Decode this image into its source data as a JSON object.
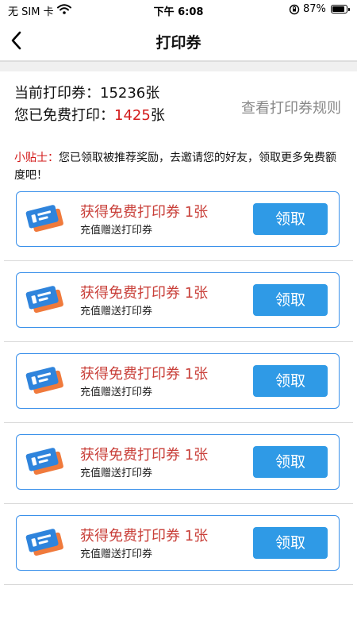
{
  "status_bar": {
    "carrier": "无 SIM 卡",
    "time": "下午 6:08",
    "battery": "87%"
  },
  "nav": {
    "title": "打印券"
  },
  "summary": {
    "current_label": "当前打印券：",
    "current_value": "15236",
    "current_unit": "张",
    "free_label": "您已免费打印：",
    "free_value": "1425",
    "free_unit": "张",
    "rules_link": "查看打印券规则"
  },
  "tip": {
    "label": "小贴士：",
    "text": "您已领取被推荐奖励，去邀请您的好友，领取更多免费额度吧！"
  },
  "coupons": [
    {
      "title": "获得免费打印券 1张",
      "subtitle": "充值赠送打印券",
      "button": "领取"
    },
    {
      "title": "获得免费打印券 1张",
      "subtitle": "充值赠送打印券",
      "button": "领取"
    },
    {
      "title": "获得免费打印券 1张",
      "subtitle": "充值赠送打印券",
      "button": "领取"
    },
    {
      "title": "获得免费打印券 1张",
      "subtitle": "充值赠送打印券",
      "button": "领取"
    },
    {
      "title": "获得免费打印券 1张",
      "subtitle": "充值赠送打印券",
      "button": "领取"
    }
  ],
  "colors": {
    "accent_blue": "#2f9ae6",
    "highlight_red": "#d31b1b",
    "coupon_title": "#c9403a"
  },
  "icons": [
    "chevron-left-icon",
    "wifi-icon",
    "orientation-lock-icon",
    "battery-icon",
    "ticket-icon"
  ]
}
